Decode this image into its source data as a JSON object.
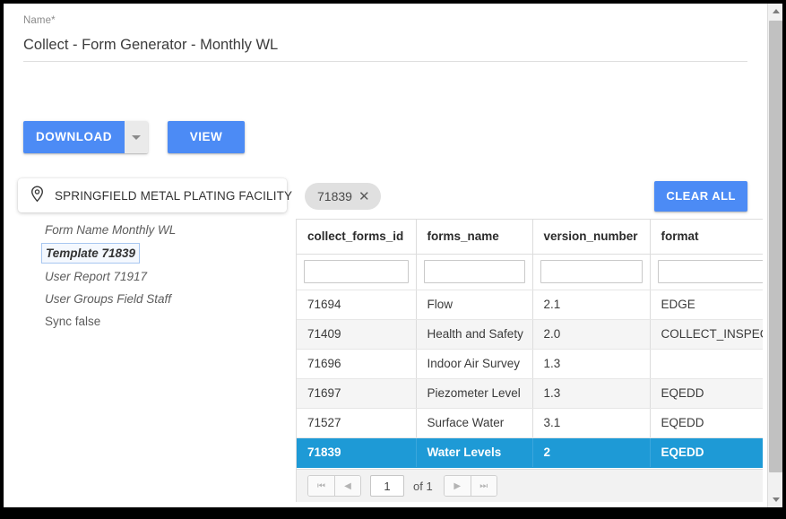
{
  "form": {
    "name_label": "Name",
    "required_marker": "*",
    "name_value": "Collect - Form Generator - Monthly WL"
  },
  "toolbar": {
    "download_label": "DOWNLOAD",
    "download_caret_icon": "chevron-down-icon",
    "view_label": "VIEW"
  },
  "facility": {
    "pin_icon": "location-pin-icon",
    "name": "SPRINGFIELD METAL PLATING FACILITY"
  },
  "meta": [
    {
      "text": "Form Name Monthly WL",
      "style": "italic"
    },
    {
      "text": "Template 71839",
      "style": "highlight"
    },
    {
      "text": "User Report 71917",
      "style": "italic"
    },
    {
      "text": "User Groups Field Staff",
      "style": "italic"
    },
    {
      "text": "Sync false",
      "style": "plain"
    }
  ],
  "filters": {
    "chip_label": "71839",
    "chip_remove_icon": "close-icon",
    "clear_all_label": "CLEAR ALL"
  },
  "grid": {
    "columns": [
      "collect_forms_id",
      "forms_name",
      "version_number",
      "format"
    ],
    "filter_values": [
      "",
      "",
      "",
      ""
    ],
    "filter_placeholders": [
      "",
      "",
      "",
      ""
    ],
    "rows": [
      {
        "cells": [
          "71694",
          "Flow",
          "2.1",
          "EDGE"
        ],
        "selected": false
      },
      {
        "cells": [
          "71409",
          "Health and Safety",
          "2.0",
          "COLLECT_INSPECTION"
        ],
        "selected": false
      },
      {
        "cells": [
          "71696",
          "Indoor Air Survey",
          "1.3",
          ""
        ],
        "selected": false
      },
      {
        "cells": [
          "71697",
          "Piezometer Level",
          "1.3",
          "EQEDD"
        ],
        "selected": false
      },
      {
        "cells": [
          "71527",
          "Surface Water",
          "3.1",
          "EQEDD"
        ],
        "selected": false
      },
      {
        "cells": [
          "71839",
          "Water Levels",
          "2",
          "EQEDD"
        ],
        "selected": true
      }
    ]
  },
  "pager": {
    "first_icon": "page-first-icon",
    "prev_icon": "page-prev-icon",
    "next_icon": "page-next-icon",
    "last_icon": "page-last-icon",
    "page_value": "1",
    "of_label": "of 1"
  },
  "scrollbar": {
    "up_icon": "scroll-up-icon",
    "down_icon": "scroll-down-icon"
  },
  "colors": {
    "accent_blue": "#4c8bf5",
    "selected_row": "#1e9ad6",
    "chip_gray": "#e0e0e0"
  }
}
